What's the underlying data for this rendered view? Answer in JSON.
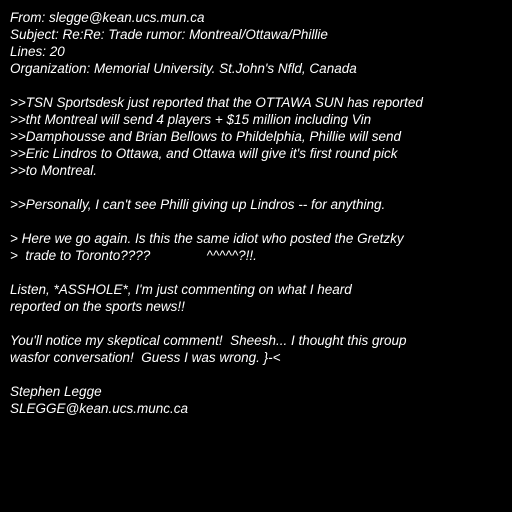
{
  "header": {
    "from": "From: slegge@kean.ucs.mun.ca",
    "subject": "Subject: Re:Re: Trade rumor: Montreal/Ottawa/Phillie",
    "lines": "Lines: 20",
    "organization": "Organization: Memorial University. St.John's Nfld, Canada"
  },
  "quote_level2_a": [
    ">>TSN Sportsdesk just reported that the OTTAWA SUN has reported",
    ">>tht Montreal will send 4 players + $15 million including Vin",
    ">>Damphousse and Brian Bellows to Phildelphia, Phillie will send",
    ">>Eric Lindros to Ottawa, and Ottawa will give it's first round pick",
    ">>to Montreal."
  ],
  "quote_level2_b": [
    ">>Personally, I can't see Philli giving up Lindros -- for anything."
  ],
  "quote_level1": [
    "> Here we go again. Is this the same idiot who posted the Gretzky",
    ">  trade to Toronto????               ^^^^^?!!."
  ],
  "reply_a": [
    "Listen, *ASSHOLE*, I'm just commenting on what I heard",
    "reported on the sports news!!"
  ],
  "reply_b": [
    "You'll notice my skeptical comment!  Sheesh... I thought this group",
    "wasfor conversation!  Guess I was wrong. }-<"
  ],
  "signature": {
    "name": "Stephen Legge",
    "email": "SLEGGE@kean.ucs.munc.ca"
  }
}
